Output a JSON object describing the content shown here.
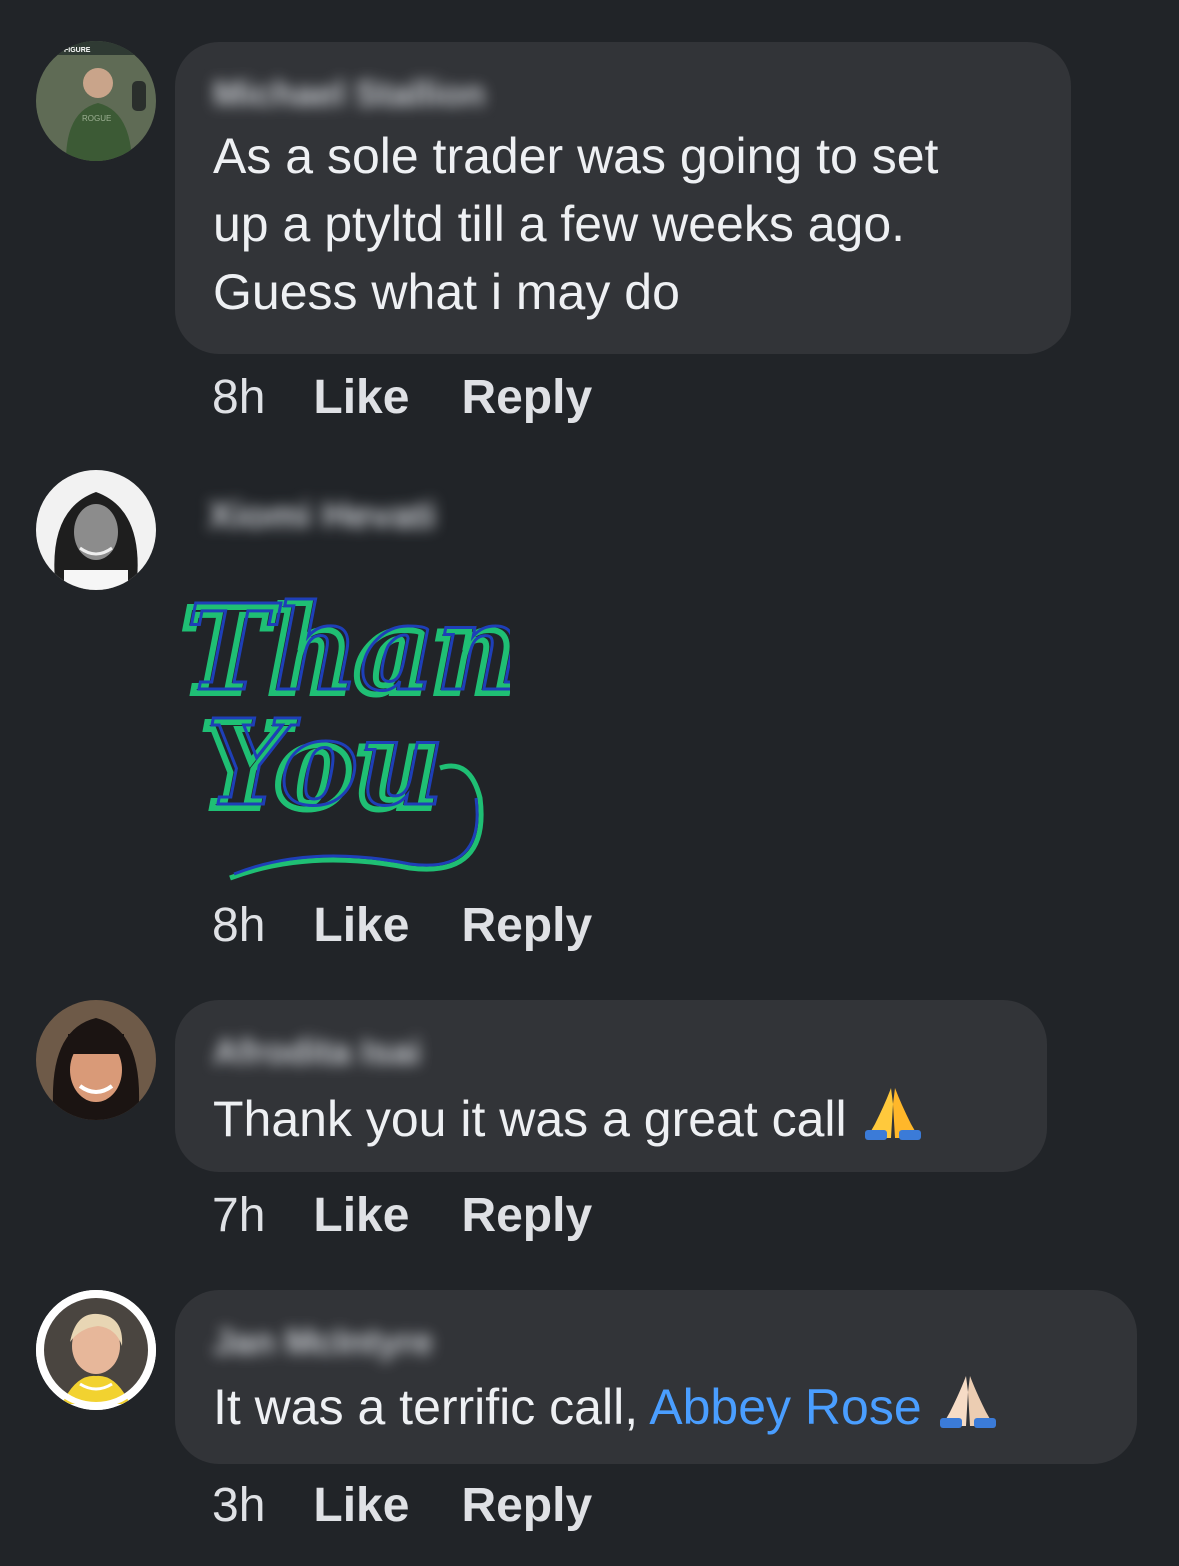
{
  "comments": [
    {
      "author": "Michael Stallion",
      "text": "As a sole trader was going to set\nup a ptyltd till a few weeks ago.\nGuess what i may do",
      "time": "8h",
      "like_label": "Like",
      "reply_label": "Reply",
      "avatar_badge": "FIGURE",
      "avatar_shirt": "ROGUE"
    },
    {
      "author": "Xiomi Hevati",
      "sticker_line1": "Thank",
      "sticker_line2": "You",
      "time": "8h",
      "like_label": "Like",
      "reply_label": "Reply"
    },
    {
      "author": "Afrodita Isai",
      "text": "Thank you it was a great call",
      "emoji": "folded-hands-icon",
      "time": "7h",
      "like_label": "Like",
      "reply_label": "Reply"
    },
    {
      "author": "Jan McIntyre",
      "text": "It was a terrific call,",
      "mention": "Abbey Rose",
      "emoji": "folded-hands-icon",
      "time": "3h",
      "like_label": "Like",
      "reply_label": "Reply"
    }
  ],
  "colors": {
    "background": "#212428",
    "bubble": "#323438",
    "mention": "#4a9eff",
    "sticker_green": "#1fbf74",
    "sticker_blue": "#1e3fb8"
  }
}
